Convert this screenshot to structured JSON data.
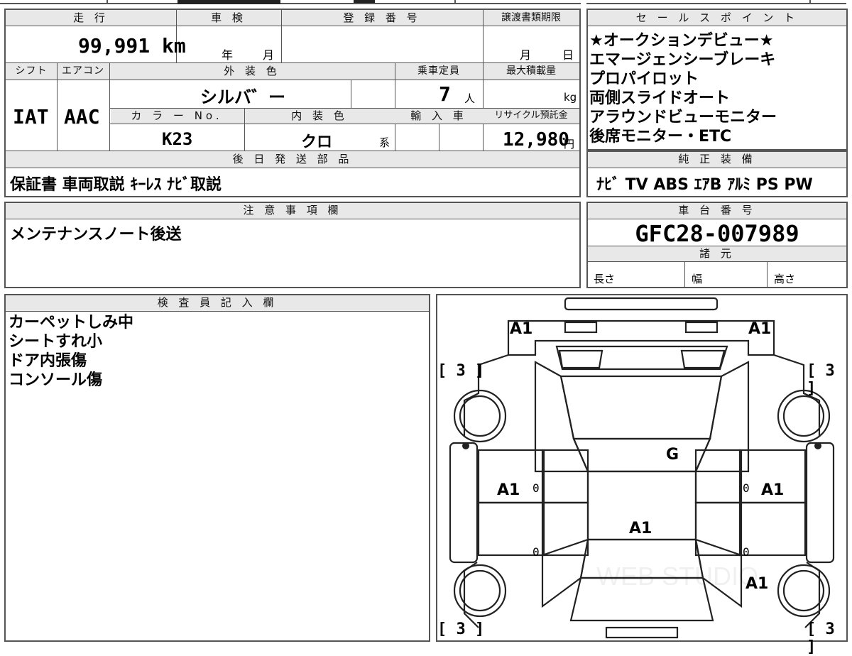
{
  "basic": {
    "mileage_label": "走 行",
    "mileage": "99,991 km",
    "shaken_label": "車 検",
    "shaken_year_unit": "年",
    "shaken_month_unit": "月",
    "registration_label": "登 録 番 号",
    "transfer_label": "譲渡書類期限",
    "transfer_month_unit": "月",
    "transfer_day_unit": "日"
  },
  "specs": {
    "shift_label": "シフト",
    "shift": "IAT",
    "ac_label": "エアコン",
    "ac": "AAC",
    "exterior_color_label": "外 装 色",
    "exterior_color": "シルバ゛ー",
    "capacity_label": "乗車定員",
    "capacity": "7",
    "capacity_unit": "人",
    "max_load_label": "最大積載量",
    "max_load_unit": "kg",
    "color_no_label": "カ ラ ー No.",
    "color_no": "K23",
    "interior_color_label": "内 装 色",
    "interior_color": "クロ",
    "interior_color_suffix": "系",
    "import_label": "輸 入 車",
    "recycle_label": "リサイクル預託金",
    "recycle_fee": "12,980",
    "recycle_unit": "円"
  },
  "later_parts": {
    "label": "後 日 発 送 部 品",
    "text": "保証書 車両取説 ｷｰﾚｽ ﾅﾋﾞ取説"
  },
  "sales_points": {
    "label": "セ ー ル ス ポ イ ン ト",
    "lines": [
      "★オークションデビュー★",
      "エマージェンシーブレーキ",
      "プロパイロット",
      "両側スライドオート",
      "アラウンドビューモニター",
      "後席モニター・ETC"
    ]
  },
  "equipment": {
    "label": "純 正 装 備",
    "text": "ﾅﾋﾞ TV ABS ｴｱB ｱﾙﾐ PS PW"
  },
  "notes": {
    "label": "注 意 事 項 欄",
    "text": "メンテナンスノート後送"
  },
  "chassis": {
    "label": "車 台 番 号",
    "number": "GFC28-007989",
    "spec_label": "諸 元",
    "length_label": "長さ",
    "width_label": "幅",
    "height_label": "高さ"
  },
  "inspector": {
    "label": "検 査 員 記 入 欄",
    "lines": [
      "カーペットしみ中",
      "シートすれ小",
      "ドア内張傷",
      "コンソール傷"
    ]
  },
  "diagram": {
    "marks": {
      "front_left": "A1",
      "front_right": "A1",
      "windshield": "G",
      "left_front_door": "A1",
      "right_front_door": "A1",
      "roof": "A1",
      "right_rear": "A1"
    },
    "tire_depth": {
      "fl": "[ 3 ]",
      "fr": "[ 3 ]",
      "rl": "[ 3 ]",
      "rr": "[ 3 ]"
    },
    "zeros": [
      "0",
      "0",
      "0",
      "0"
    ],
    "watermark": "WEB STUDIO"
  }
}
